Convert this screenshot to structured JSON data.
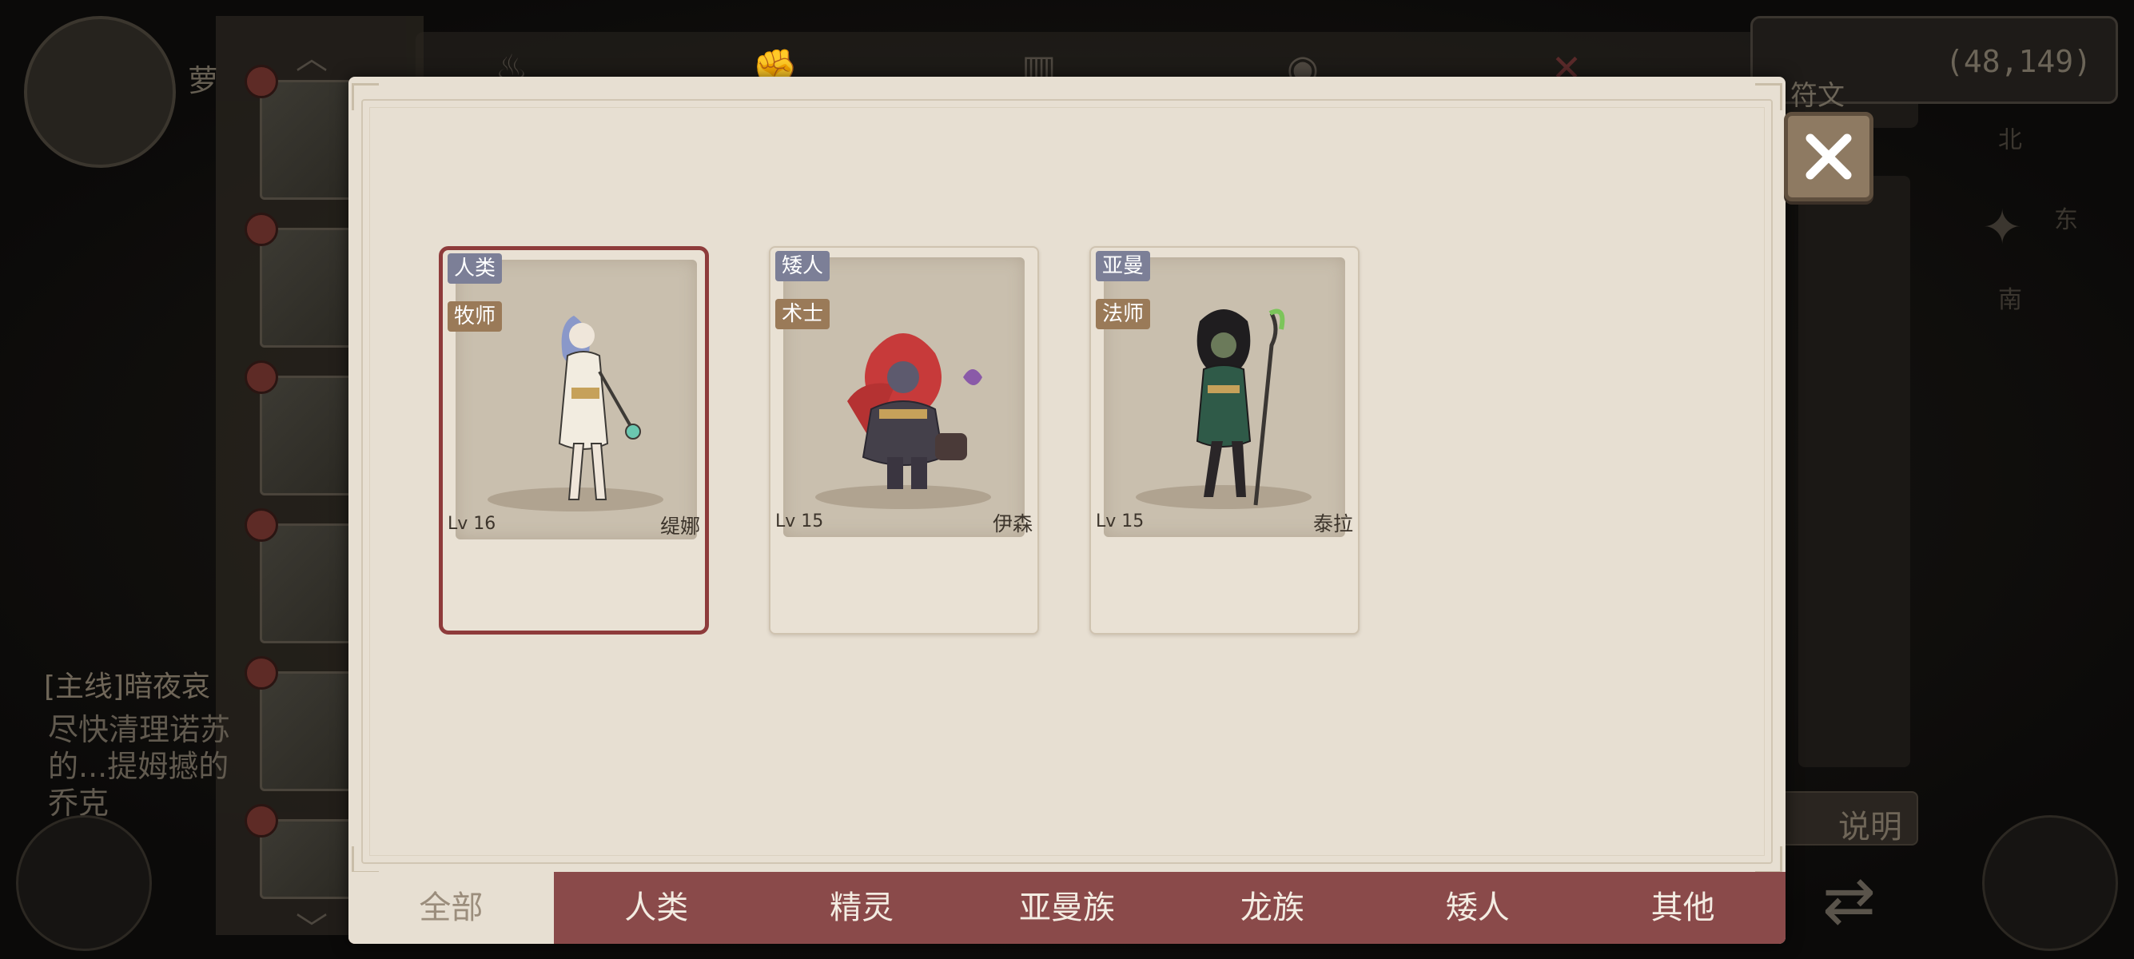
{
  "background": {
    "coords": "(48,149)",
    "rune_label": "符文",
    "player_name": "萝",
    "quest_title": "[主线]暗夜哀",
    "quest_body": "尽快清理诺苏的...提姆撼的乔克",
    "help_label": "说明",
    "compass": {
      "north": "北",
      "east": "东",
      "south": "南"
    }
  },
  "modal": {
    "close_icon": "close-x-icon",
    "heroes": [
      {
        "race": "人类",
        "class": "牧师",
        "level": "Lv 16",
        "name": "缇娜",
        "selected": true
      },
      {
        "race": "矮人",
        "class": "术士",
        "level": "Lv 15",
        "name": "伊森",
        "selected": false
      },
      {
        "race": "亚曼",
        "class": "法师",
        "level": "Lv 15",
        "name": "泰拉",
        "selected": false
      }
    ],
    "tabs": [
      "全部",
      "人类",
      "精灵",
      "亚曼族",
      "龙族",
      "矮人",
      "其他"
    ],
    "active_tab": "全部"
  },
  "colors": {
    "modal_bg": "#e7dfd2",
    "tab_bar": "#8a4a4a",
    "selected_border": "#8e3b3b",
    "race_tag": "#7c7f97",
    "class_tag": "#9a7a58"
  }
}
